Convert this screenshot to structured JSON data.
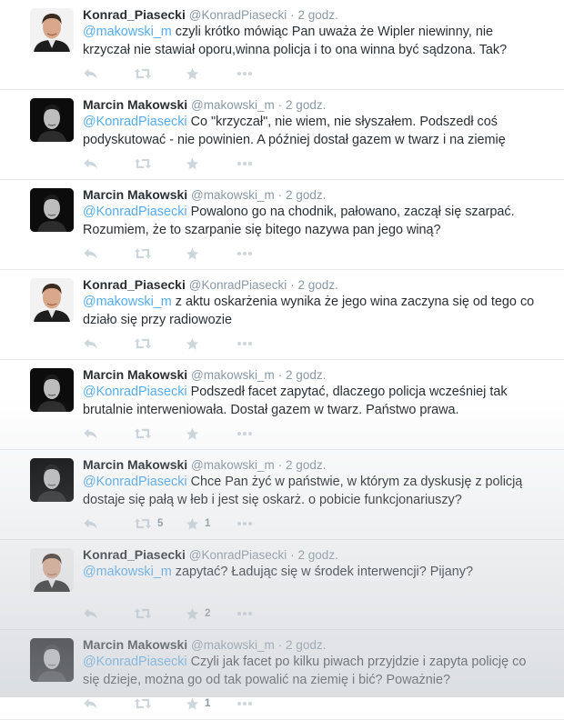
{
  "tweets": [
    {
      "author": "piasecki",
      "name": "Konrad_Piasecki",
      "handle": "@KonradPiasecki",
      "separator": "·",
      "time": "2 godz.",
      "mention": "@makowski_m",
      "body": " czyli krótko mówiąc Pan uważa że Wipler niewinny, nie krzyczał nie stawiał oporu,winna policja i to ona winna być sądzona. Tak?",
      "retweets": "",
      "favorites": ""
    },
    {
      "author": "makowski",
      "name": "Marcin Makowski",
      "handle": "@makowski_m",
      "separator": "·",
      "time": "2 godz.",
      "mention": "@KonradPiasecki",
      "body": " Co \"krzyczał\", nie wiem, nie słyszałem. Podszedł coś podyskutować - nie powinien. A później dostał gazem w twarz i na ziemię",
      "retweets": "",
      "favorites": ""
    },
    {
      "author": "makowski",
      "name": "Marcin Makowski",
      "handle": "@makowski_m",
      "separator": "·",
      "time": "2 godz.",
      "mention": "@KonradPiasecki",
      "body": " Powalono go na chodnik, pałowano, zaczął się szarpać. Rozumiem, że to szarpanie się bitego nazywa pan jego winą?",
      "retweets": "",
      "favorites": ""
    },
    {
      "author": "piasecki",
      "name": "Konrad_Piasecki",
      "handle": "@KonradPiasecki",
      "separator": "·",
      "time": "2 godz.",
      "mention": "@makowski_m",
      "body": " z aktu oskarżenia wynika że jego wina zaczyna się od tego co działo się przy radiowozie",
      "retweets": "",
      "favorites": ""
    },
    {
      "author": "makowski",
      "name": "Marcin Makowski",
      "handle": "@makowski_m",
      "separator": "·",
      "time": "2 godz.",
      "mention": "@KonradPiasecki",
      "body": " Podszedł facet zapytać, dlaczego policja wcześniej tak brutalnie interweniowała. Dostał gazem w twarz. Państwo prawa.",
      "retweets": "",
      "favorites": ""
    },
    {
      "author": "makowski",
      "name": "Marcin Makowski",
      "handle": "@makowski_m",
      "separator": "·",
      "time": "2 godz.",
      "mention": "@KonradPiasecki",
      "body": " Chce Pan żyć w państwie, w którym za dyskusję z policją dostaje się pałą w łeb i jest się oskarż. o pobicie funkcjonariuszy?",
      "retweets": "5",
      "favorites": "1"
    },
    {
      "author": "piasecki",
      "name": "Konrad_Piasecki",
      "handle": "@KonradPiasecki",
      "separator": "·",
      "time": "2 godz.",
      "mention": "@makowski_m",
      "body": " zapytać? Ładując się w środek interwencji? Pijany?",
      "retweets": "",
      "favorites": "2"
    },
    {
      "author": "makowski",
      "name": "Marcin Makowski",
      "handle": "@makowski_m",
      "separator": "·",
      "time": "2 godz.",
      "mention": "@KonradPiasecki",
      "body": " Czyli jak facet po kilku piwach przyjdzie i zapyta policję co się dzieje, można go od tak powalić na ziemię i bić? Poważnie?",
      "retweets": "",
      "favorites": "1"
    }
  ],
  "icons": {
    "reply": "reply-icon",
    "retweet": "retweet-icon",
    "favorite": "star-icon",
    "more": "more-icon"
  },
  "colors": {
    "name": "#292f33",
    "meta": "#8899a6",
    "mention": "#55acee",
    "action": "#ccd6dd"
  }
}
